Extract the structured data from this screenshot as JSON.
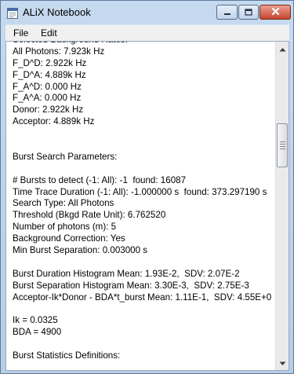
{
  "window": {
    "title": "ALiX Notebook",
    "accent": "#c6452e"
  },
  "menu": {
    "items": [
      "File",
      "Edit"
    ]
  },
  "icons": {
    "app": "window-app-icon",
    "minimize": "minimize-icon",
    "maximize": "maximize-icon",
    "close": "close-icon",
    "scroll_up": "chevron-up-icon",
    "scroll_down": "chevron-down-icon"
  },
  "notebook": {
    "lines": [
      "Selected Background Rates:",
      "All Photons: 7.923k Hz",
      "F_D^D: 2.922k Hz",
      "F_D^A: 4.889k Hz",
      "F_A^D: 0.000 Hz",
      "F_A^A: 0.000 Hz",
      "Donor: 2.922k Hz",
      "Acceptor: 4.889k Hz",
      "",
      "",
      "Burst Search Parameters:",
      "",
      "# Bursts to detect (-1: All): -1  found: 16087",
      "Time Trace Duration (-1: All): -1.000000 s  found: 373.297190 s",
      "Search Type: All Photons",
      "Threshold (Bkgd Rate Unit): 6.762520",
      "Number of photons (m): 5",
      "Background Correction: Yes",
      "Min Burst Separation: 0.003000 s",
      "",
      "Burst Duration Histogram Mean: 1.93E-2,  SDV: 2.07E-2",
      "Burst Separation Histogram Mean: 3.30E-3,  SDV: 2.75E-3",
      "Acceptor-Ik*Donor - BDA*t_burst Mean: 1.11E-1,  SDV: 4.55E+0",
      "",
      "Ik = 0.0325",
      "BDA = 4900",
      "",
      "Burst Statistics Definitions:",
      ""
    ]
  }
}
